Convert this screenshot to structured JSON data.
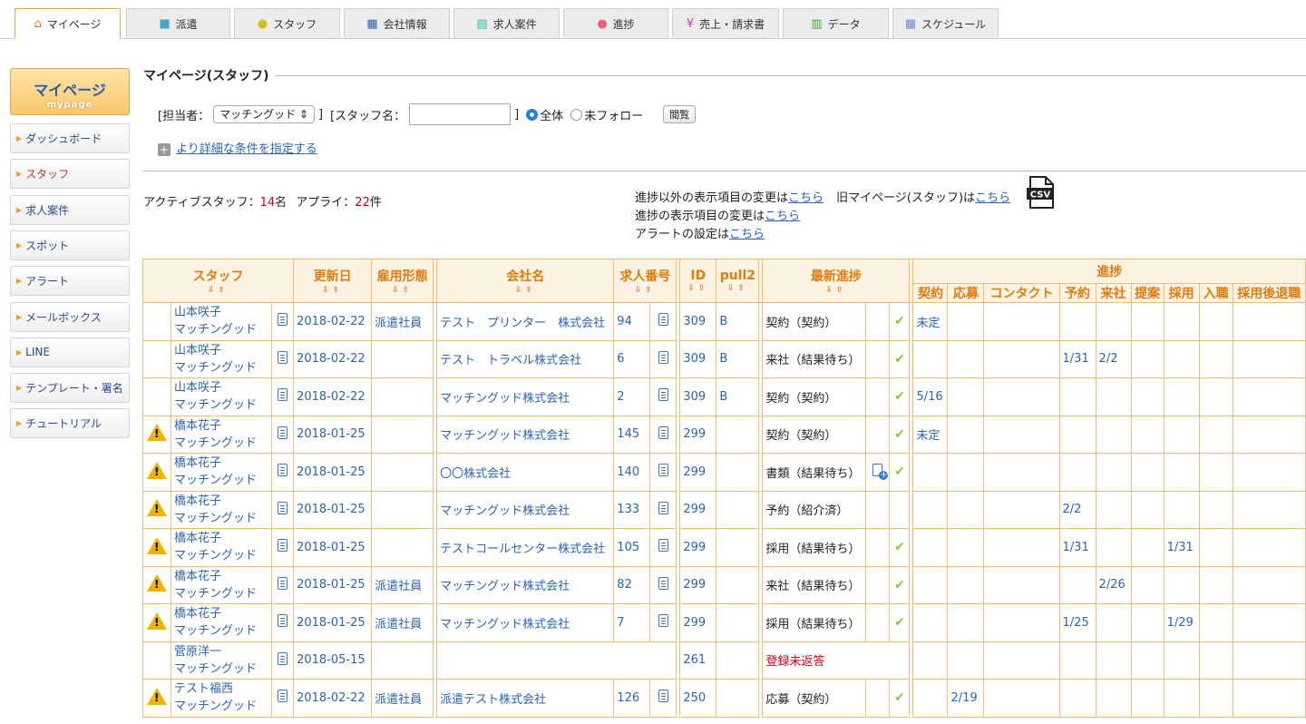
{
  "tabs": [
    {
      "label": "マイページ",
      "icon": "home-icon",
      "glyph": "⌂",
      "color": "#e0741a"
    },
    {
      "label": "派遣",
      "icon": "briefcase-icon",
      "glyph": "■",
      "color": "#4aa3c8"
    },
    {
      "label": "スタッフ",
      "icon": "person-icon",
      "glyph": "●",
      "color": "#d4c21a"
    },
    {
      "label": "会社情報",
      "icon": "building-icon",
      "glyph": "▦",
      "color": "#2a63b8"
    },
    {
      "label": "求人案件",
      "icon": "document-icon",
      "glyph": "▤",
      "color": "#3ab4a8"
    },
    {
      "label": "進捗",
      "icon": "pin-icon",
      "glyph": "●",
      "color": "#e8607a"
    },
    {
      "label": "売上・請求書",
      "icon": "yen-icon",
      "glyph": "¥",
      "color": "#b84ac0"
    },
    {
      "label": "データ",
      "icon": "bar-chart-icon",
      "glyph": "▥",
      "color": "#3aa83a"
    },
    {
      "label": "スケジュール",
      "icon": "calendar-icon",
      "glyph": "▦",
      "color": "#6a8ad8"
    }
  ],
  "sidebar": {
    "head_title": "マイページ",
    "head_sub": "mypage",
    "items": [
      "ダッシュボード",
      "スタッフ",
      "求人案件",
      "スポット",
      "アラート",
      "メールボックス",
      "LINE",
      "テンプレート・署名",
      "チュートリアル"
    ]
  },
  "panel": {
    "title": "マイページ(スタッフ)",
    "tanto_label": "[担当者：",
    "tanto_value": "マッチングッド",
    "bracket_close": "]",
    "staff_label": "[スタッフ名：",
    "staff_close": "]",
    "radio_all": "全体",
    "radio_unfollow": "未フォロー",
    "view_button": "閲覧",
    "more_link": "より詳細な条件を指定する"
  },
  "stats": {
    "active_label": "アクティブスタッフ：",
    "active_count": "14",
    "active_unit": "名",
    "apply_label": "アプライ：",
    "apply_count": "22",
    "apply_unit": "件"
  },
  "links": {
    "line1_text": "進捗以外の表示項目の変更は",
    "line1_link": "こちら",
    "line1b_text": "旧マイページ(スタッフ)は",
    "line1b_link": "こちら",
    "line2_text": "進捗の表示項目の変更は",
    "line2_link": "こちら",
    "line3_text": "アラートの設定は",
    "line3_link": "こちら",
    "csv_label": "CSV"
  },
  "table": {
    "headers": {
      "staff": "スタッフ",
      "updated": "更新日",
      "employment": "雇用形態",
      "company": "会社名",
      "job_no": "求人番号",
      "id": "ID",
      "pull2": "pull2",
      "latest": "最新進捗",
      "progress": "進捗",
      "sort_arrows": "⇩⇧"
    },
    "progress_cols": [
      "契約",
      "応募",
      "コンタクト",
      "予約",
      "来社",
      "提案",
      "採用",
      "入職",
      "採用後退職"
    ],
    "rows": [
      {
        "alert": false,
        "name": "山本咲子",
        "owner": "マッチングッド",
        "date": "2018-02-22",
        "emp": "派遣社員",
        "company": "テスト　プリンター　株式会社",
        "job": "94",
        "jobdoc": true,
        "id": "309",
        "pull2": "B",
        "status": "契約（契約）",
        "status_red": false,
        "edit": false,
        "check": true,
        "p": [
          "未定",
          "",
          "",
          "",
          "",
          "",
          "",
          "",
          ""
        ]
      },
      {
        "alert": false,
        "name": "山本咲子",
        "owner": "マッチングッド",
        "date": "2018-02-22",
        "emp": "",
        "company": "テスト　トラベル株式会社",
        "job": "6",
        "jobdoc": true,
        "id": "309",
        "pull2": "B",
        "status": "来社（結果待ち）",
        "status_red": false,
        "edit": false,
        "check": true,
        "p": [
          "",
          "",
          "",
          "1/31",
          "2/2",
          "",
          "",
          "",
          ""
        ]
      },
      {
        "alert": false,
        "name": "山本咲子",
        "owner": "マッチングッド",
        "date": "2018-02-22",
        "emp": "",
        "company": "マッチングッド株式会社",
        "job": "2",
        "jobdoc": true,
        "id": "309",
        "pull2": "B",
        "status": "契約（契約）",
        "status_red": false,
        "edit": false,
        "check": true,
        "p": [
          "5/16",
          "",
          "",
          "",
          "",
          "",
          "",
          "",
          ""
        ]
      },
      {
        "alert": true,
        "name": "橋本花子",
        "owner": "マッチングッド",
        "date": "2018-01-25",
        "emp": "",
        "company": "マッチングッド株式会社",
        "job": "145",
        "jobdoc": true,
        "id": "299",
        "pull2": "",
        "status": "契約（契約）",
        "status_red": false,
        "edit": false,
        "check": true,
        "p": [
          "未定",
          "",
          "",
          "",
          "",
          "",
          "",
          "",
          ""
        ]
      },
      {
        "alert": true,
        "name": "橋本花子",
        "owner": "マッチングッド",
        "date": "2018-01-25",
        "emp": "",
        "company": "〇〇株式会社",
        "job": "140",
        "jobdoc": true,
        "id": "299",
        "pull2": "",
        "status": "書類（結果待ち）",
        "status_red": false,
        "edit": true,
        "check": true,
        "p": [
          "",
          "",
          "",
          "",
          "",
          "",
          "",
          "",
          ""
        ]
      },
      {
        "alert": true,
        "name": "橋本花子",
        "owner": "マッチングッド",
        "date": "2018-01-25",
        "emp": "",
        "company": "マッチングッド株式会社",
        "job": "133",
        "jobdoc": true,
        "id": "299",
        "pull2": "",
        "status": "予約（紹介済）",
        "status_red": false,
        "edit": false,
        "check": false,
        "p": [
          "",
          "",
          "",
          "2/2",
          "",
          "",
          "",
          "",
          ""
        ]
      },
      {
        "alert": true,
        "name": "橋本花子",
        "owner": "マッチングッド",
        "date": "2018-01-25",
        "emp": "",
        "company": "テストコールセンター株式会社",
        "job": "105",
        "jobdoc": true,
        "id": "299",
        "pull2": "",
        "status": "採用（結果待ち）",
        "status_red": false,
        "edit": false,
        "check": true,
        "p": [
          "",
          "",
          "",
          "1/31",
          "",
          "",
          "1/31",
          "",
          ""
        ]
      },
      {
        "alert": true,
        "name": "橋本花子",
        "owner": "マッチングッド",
        "date": "2018-01-25",
        "emp": "派遣社員",
        "company": "マッチングッド株式会社",
        "job": "82",
        "jobdoc": true,
        "id": "299",
        "pull2": "",
        "status": "来社（結果待ち）",
        "status_red": false,
        "edit": false,
        "check": true,
        "p": [
          "",
          "",
          "",
          "",
          "2/26",
          "",
          "",
          "",
          ""
        ]
      },
      {
        "alert": true,
        "name": "橋本花子",
        "owner": "マッチングッド",
        "date": "2018-01-25",
        "emp": "派遣社員",
        "company": "マッチングッド株式会社",
        "job": "7",
        "jobdoc": true,
        "id": "299",
        "pull2": "",
        "status": "採用（結果待ち）",
        "status_red": false,
        "edit": false,
        "check": true,
        "p": [
          "",
          "",
          "",
          "1/25",
          "",
          "",
          "1/29",
          "",
          ""
        ]
      },
      {
        "alert": false,
        "name": "菅原洋一",
        "owner": "マッチングッド",
        "date": "2018-05-15",
        "emp": "",
        "company": "",
        "job": "",
        "jobdoc": false,
        "id": "261",
        "pull2": "",
        "status": "登録未返答",
        "status_red": true,
        "edit": false,
        "check": false,
        "p": [
          "",
          "",
          "",
          "",
          "",
          "",
          "",
          "",
          ""
        ]
      },
      {
        "alert": true,
        "name": "テスト福西",
        "owner": "マッチングッド",
        "date": "2018-02-22",
        "emp": "派遣社員",
        "company": "派遣テスト株式会社",
        "job": "126",
        "jobdoc": true,
        "id": "250",
        "pull2": "",
        "status": "応募（契約）",
        "status_red": false,
        "edit": false,
        "check": true,
        "p": [
          "",
          "2/19",
          "",
          "",
          "",
          "",
          "",
          "",
          ""
        ]
      }
    ]
  }
}
